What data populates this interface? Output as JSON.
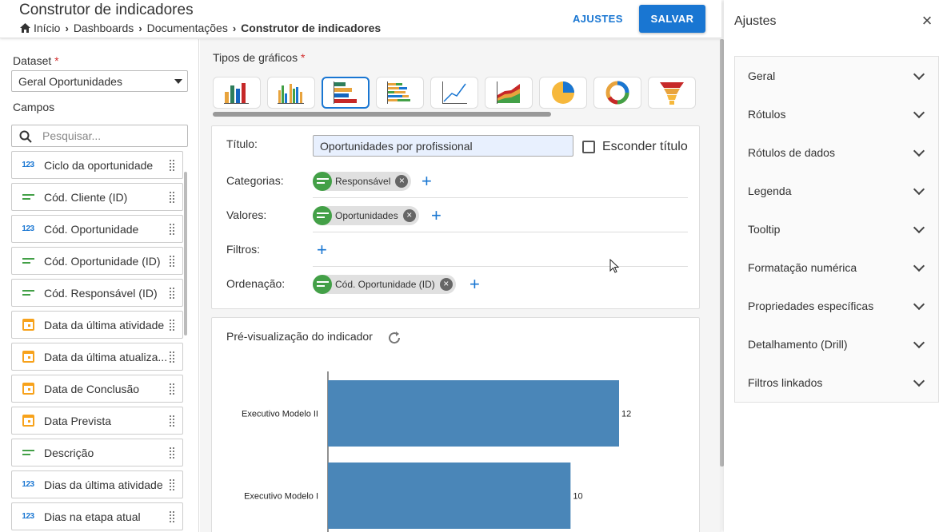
{
  "header": {
    "title": "Construtor de indicadores",
    "breadcrumb": [
      "Início",
      "Dashboards",
      "Documentações",
      "Construtor de indicadores"
    ],
    "ajustes_label": "AJUSTES",
    "salvar_label": "SALVAR",
    "accent": "#1976d2"
  },
  "sidebar": {
    "dataset_label": "Dataset",
    "required_mark": "*",
    "dataset_value": "Geral Oportunidades",
    "campos_label": "Campos",
    "search_placeholder": "Pesquisar...",
    "fields": [
      {
        "name": "Ciclo da oportunidade",
        "type": "number"
      },
      {
        "name": "Cód. Cliente (ID)",
        "type": "text"
      },
      {
        "name": "Cód. Oportunidade",
        "type": "number"
      },
      {
        "name": "Cód. Oportunidade (ID)",
        "type": "text"
      },
      {
        "name": "Cód. Responsável (ID)",
        "type": "text"
      },
      {
        "name": "Data da última atividade",
        "type": "date"
      },
      {
        "name": "Data da última atualiza...",
        "type": "date"
      },
      {
        "name": "Data de Conclusão",
        "type": "date"
      },
      {
        "name": "Data Prevista",
        "type": "date"
      },
      {
        "name": "Descrição",
        "type": "text"
      },
      {
        "name": "Dias da última atividade",
        "type": "number"
      },
      {
        "name": "Dias na etapa atual",
        "type": "number"
      }
    ],
    "number_icon_text": "123"
  },
  "builder": {
    "chart_types_label": "Tipos de gráficos",
    "chart_types": [
      "bar-chart-icon",
      "grouped-bar-chart-icon",
      "horizontal-bar-chart-icon",
      "stacked-horizontal-bar-icon",
      "line-chart-icon",
      "area-chart-icon",
      "pie-chart-icon",
      "donut-chart-icon",
      "funnel-chart-icon"
    ],
    "selected_chart_type": "horizontal-bar-chart-icon",
    "titulo_label": "Título:",
    "titulo_value": "Oportunidades por profissional",
    "hide_title_label": "Esconder título",
    "categorias_label": "Categorias:",
    "categorias_chip": "Responsável",
    "valores_label": "Valores:",
    "valores_chip": "Oportunidades",
    "filtros_label": "Filtros:",
    "ordenacao_label": "Ordenação:",
    "ordenacao_chip": "Cód. Oportunidade (ID)"
  },
  "preview": {
    "title": "Pré-visualização do indicador"
  },
  "chart_data": {
    "type": "bar",
    "orientation": "horizontal",
    "categories": [
      "Executivo Modelo II",
      "Executivo Modelo I"
    ],
    "values": [
      12,
      10
    ],
    "bar_color": "#4a86b8",
    "title": "",
    "xlabel": "",
    "ylabel": ""
  },
  "settings": {
    "title": "Ajustes",
    "sections": [
      "Geral",
      "Rótulos",
      "Rótulos de dados",
      "Legenda",
      "Tooltip",
      "Formatação numérica",
      "Propriedades específicas",
      "Detalhamento (Drill)",
      "Filtros linkados"
    ]
  }
}
